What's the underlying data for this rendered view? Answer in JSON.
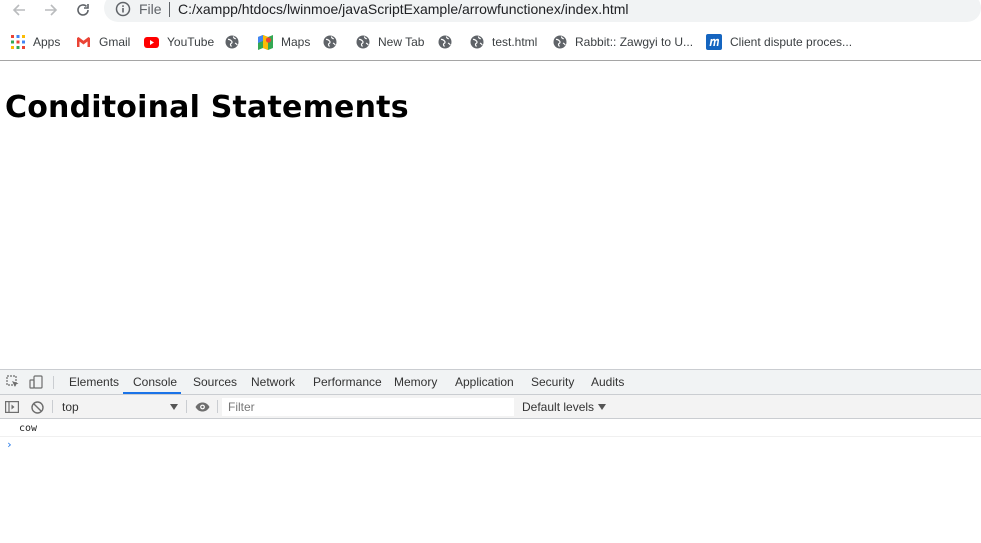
{
  "browser": {
    "address": {
      "scheme_label": "File",
      "url": "C:/xampp/htdocs/lwinmoe/javaScriptExample/arrowfunctionex/index.html"
    },
    "bookmarks": [
      {
        "label": "Apps",
        "icon": "apps-grid-icon"
      },
      {
        "label": "Gmail",
        "icon": "gmail-icon"
      },
      {
        "label": "YouTube",
        "icon": "youtube-icon"
      },
      {
        "label": "",
        "icon": "globe-icon"
      },
      {
        "label": "Maps",
        "icon": "maps-icon"
      },
      {
        "label": "",
        "icon": "globe-icon"
      },
      {
        "label": "New Tab",
        "icon": "globe-icon"
      },
      {
        "label": "",
        "icon": "globe-icon"
      },
      {
        "label": "test.html",
        "icon": "globe-icon"
      },
      {
        "label": "Rabbit:: Zawgyi to U...",
        "icon": "globe-icon"
      },
      {
        "label": "Client dispute proces...",
        "icon": "m-app-icon"
      }
    ]
  },
  "page": {
    "heading": "Conditoinal Statements"
  },
  "devtools": {
    "tabs": [
      "Elements",
      "Console",
      "Sources",
      "Network",
      "Performance",
      "Memory",
      "Application",
      "Security",
      "Audits"
    ],
    "active_tab": "Console",
    "console": {
      "context": "top",
      "filter_placeholder": "Filter",
      "levels": "Default levels",
      "messages": [
        "cow"
      ],
      "prompt": "›"
    }
  },
  "colors": {
    "accent": "#1a73e8",
    "omnibox_bg": "#f1f3f4",
    "devtools_bar_bg": "#f1f3f4"
  }
}
